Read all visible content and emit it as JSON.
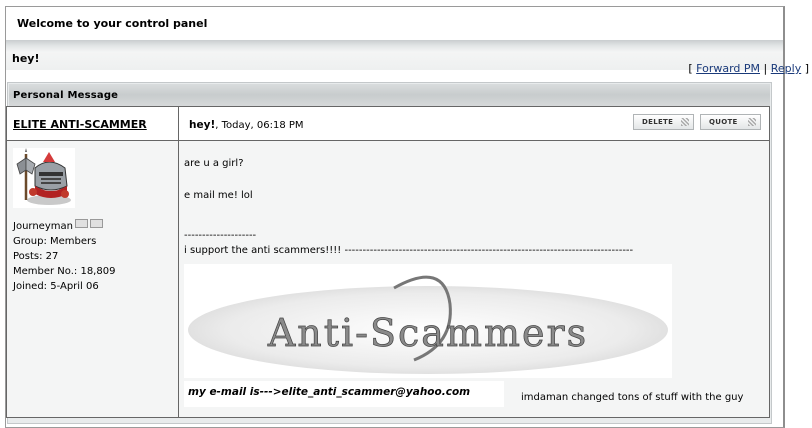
{
  "header": {
    "welcome": "Welcome to your control panel"
  },
  "pm": {
    "subject_bar": "hey!",
    "nav": {
      "open": "[",
      "forward": "Forward PM",
      "sep": "|",
      "reply": "Reply",
      "close": "]"
    },
    "section_title": "Personal Message",
    "author": {
      "name": "ELITE ANTI-SCAMMER",
      "rank": "Journeyman",
      "group": "Group: Members",
      "posts": "Posts: 27",
      "member_no": "Member No.: 18,809",
      "joined": "Joined: 5-April 06",
      "avatar_icon": "knight-with-axe-avatar"
    },
    "message": {
      "title": "hey!",
      "date": ", Today, 06:18 PM",
      "delete_label": "DELETE",
      "quote_label": "QUOTE",
      "line1": "are u a girl?",
      "line2": "e mail me! lol",
      "dashes_short": "--------------------",
      "signature": "i support the anti scammers!!!! --------------------------------------------------------------------------------",
      "dashes_long": "----------------------------------------------",
      "banner_text": "Anti-Scammers",
      "email_text": "my e-mail is--->elite_anti_scammer@yahoo.com",
      "trailing_text": "imdaman changed tons of stuff with the guy"
    }
  }
}
